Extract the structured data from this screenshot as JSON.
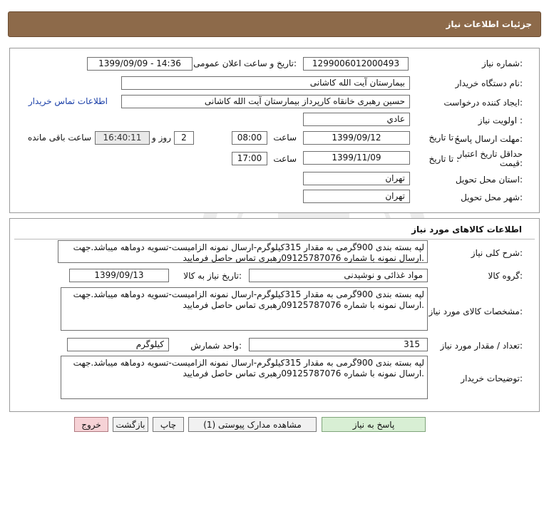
{
  "header": {
    "title": "جزئیات اطلاعات نیاز"
  },
  "info": {
    "need_number_label": "شماره نیاز:",
    "need_number": "1299006012000493",
    "announce_label": "تاریخ و ساعت اعلان عمومی:",
    "announce_value": "1399/09/09 - 14:36",
    "buyer_org_label": "نام دستگاه خریدار:",
    "buyer_org": "بیمارستان آیت الله کاشانی",
    "requester_label": "ایجاد کننده درخواست:",
    "requester": "حسین رهبری خانقاه کارپرداز بیمارستان آیت الله کاشانی",
    "contact_link": "اطلاعات تماس خریدار",
    "priority_label": "اولویت نیاز :",
    "priority": "عادي",
    "deadline_label": "مهلت ارسال پاسخ:",
    "until_date_label": "تا تاریخ :",
    "deadline_date": "1399/09/12",
    "time_label": "ساعت",
    "deadline_time": "08:00",
    "days": "2",
    "days_suffix": "روز و",
    "remaining_time": "16:40:11",
    "remaining_label": "ساعت باقی مانده",
    "validity_label": "حداقل تاریخ اعتبار قیمت:",
    "validity_until_label": "تا تاریخ :",
    "validity_date": "1399/11/09",
    "validity_time_label": "ساعت",
    "validity_time": "17:00",
    "province_label": "استان محل تحویل:",
    "province": "تهران",
    "city_label": "شهر محل تحویل:",
    "city": "تهران"
  },
  "goods": {
    "section_title": "اطلاعات کالاهای مورد نیاز",
    "description_label": "شرح کلی نیاز:",
    "description": "لپه بسته بندی 900گرمی به مقدار 315کیلوگرم-ارسال نمونه الزامیست-تسویه دوماهه میباشد.جهت ارسال نمونه با شماره 09125787076رهبری تماس حاصل فرمایید.",
    "group_label": "گروه کالا:",
    "group": "مواد غذائی و نوشیدنی",
    "need_date_label": "تاریخ نیاز به کالا:",
    "need_date": "1399/09/13",
    "specs_label": "مشخصات کالای مورد نیاز:",
    "specs": "لپه بسته بندی 900گرمی به مقدار 315کیلوگرم-ارسال نمونه الزامیست-تسویه دوماهه میباشد.جهت ارسال نمونه با شماره 09125787076رهبری تماس حاصل فرمایید.",
    "qty_label": "تعداد / مقدار مورد نیاز:",
    "qty": "315",
    "unit_label": "واحد شمارش:",
    "unit": "کیلوگرم",
    "buyer_notes_label": "توضیحات خریدار:",
    "buyer_notes": "لپه بسته بندی 900گرمی به مقدار 315کیلوگرم-ارسال نمونه الزامیست-تسویه دوماهه میباشد.جهت ارسال نمونه با شماره 09125787076رهبری تماس حاصل فرمایید."
  },
  "buttons": {
    "reply": "پاسخ به نیاز",
    "attachments": "مشاهده مدارک پیوستی (1)",
    "print": "چاپ",
    "back": "بازگشت",
    "exit": "خروج"
  },
  "colors": {
    "header_bg": "#8d6a4a",
    "reply_bg": "#d8efd4",
    "exit_bg": "#f6d2d6",
    "link": "#1a3fa8"
  }
}
